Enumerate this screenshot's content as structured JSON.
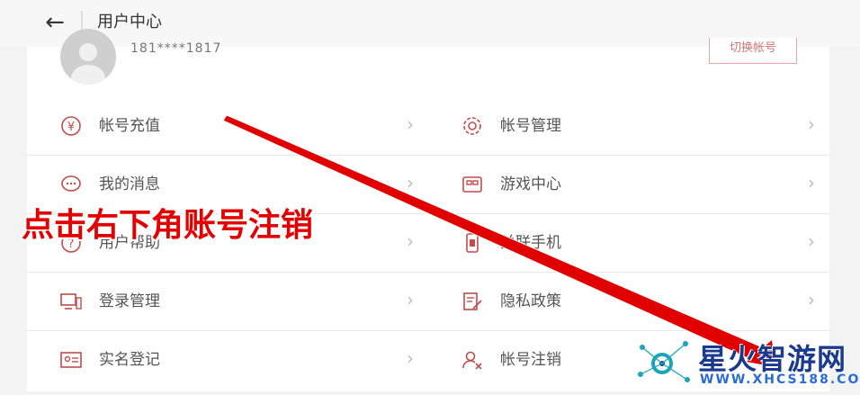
{
  "header": {
    "back_icon": "back-arrow-icon",
    "title": "用户中心"
  },
  "profile": {
    "user_id": "181****1817",
    "switch_button": "切换帐号"
  },
  "menu": {
    "items": [
      {
        "label": "帐号充值",
        "icon": "yuan-icon"
      },
      {
        "label": "帐号管理",
        "icon": "gear-icon"
      },
      {
        "label": "我的消息",
        "icon": "message-icon"
      },
      {
        "label": "游戏中心",
        "icon": "gamepad-icon"
      },
      {
        "label": "用户帮助",
        "icon": "help-icon"
      },
      {
        "label": "关联手机",
        "icon": "phone-icon"
      },
      {
        "label": "登录管理",
        "icon": "devices-icon"
      },
      {
        "label": "隐私政策",
        "icon": "document-edit-icon"
      },
      {
        "label": "实名登记",
        "icon": "id-card-icon"
      },
      {
        "label": "帐号注销",
        "icon": "user-remove-icon"
      }
    ]
  },
  "overlay": {
    "caption": "点击右下角账号注销"
  },
  "watermark": {
    "name": "星火智游网",
    "site": "WWW.XHCS188.COM"
  },
  "colors": {
    "accent": "#c34b4b",
    "caption": "#e50000",
    "arrow": "#e00000"
  }
}
